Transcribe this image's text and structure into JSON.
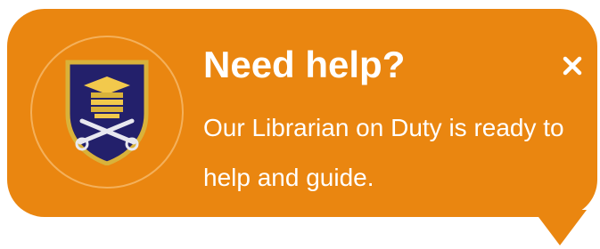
{
  "popup": {
    "title": "Need help?",
    "message": "Our Librarian on Duty is ready to help and guide.",
    "close_icon": "close-icon",
    "logo_icon": "university-crest-logo",
    "colors": {
      "background": "#ea8610",
      "text": "#ffffff",
      "ring": "#f4b05a",
      "crest_blue": "#23206b",
      "crest_gold": "#d9b23a"
    }
  }
}
